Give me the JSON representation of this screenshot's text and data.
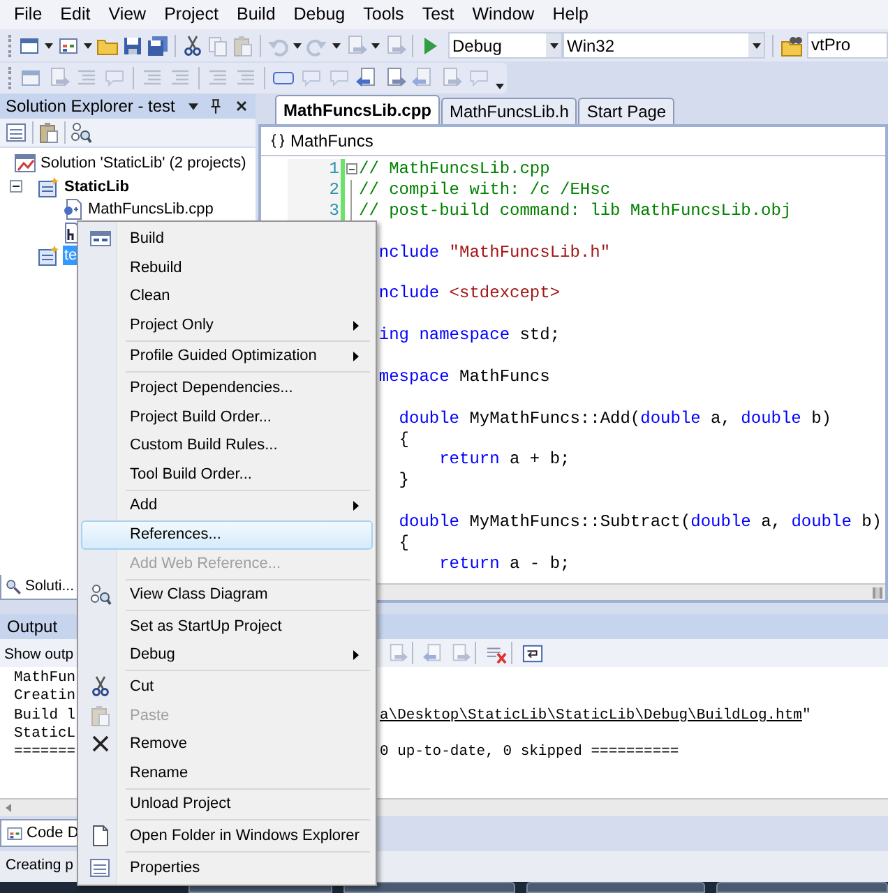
{
  "menu_bar": [
    "File",
    "Edit",
    "View",
    "Project",
    "Build",
    "Debug",
    "Tools",
    "Test",
    "Window",
    "Help"
  ],
  "toolbar": {
    "configuration": "Debug",
    "platform": "Win32",
    "find_box": "vtPro"
  },
  "solution_explorer": {
    "title": "Solution Explorer - test",
    "tree": [
      {
        "label": "Solution 'StaticLib' (2 projects)",
        "kind": "solution",
        "selected": false,
        "children": [
          {
            "label": "StaticLib",
            "kind": "project",
            "startup": true,
            "expanded": true,
            "selected": false,
            "children": [
              {
                "label": "MathFuncsLib.cpp",
                "kind": "cpp",
                "selected": false
              },
              {
                "kind": "header",
                "selected": false
              }
            ]
          },
          {
            "label": "te",
            "kind": "project",
            "startup": false,
            "selected": true
          }
        ]
      }
    ],
    "bottom_tab": "Soluti..."
  },
  "editor": {
    "tabs": [
      {
        "label": "MathFuncsLib.cpp",
        "selected": true
      },
      {
        "label": "MathFuncsLib.h",
        "selected": false
      },
      {
        "label": "Start Page",
        "selected": false
      }
    ],
    "navigation": "MathFuncs",
    "code_lines": [
      {
        "kind": "code",
        "number": "1",
        "collapsible": true,
        "segments": [
          {
            "kind": "comment",
            "text": "// MathFuncsLib.cpp"
          }
        ]
      },
      {
        "kind": "code",
        "number": "2",
        "segments": [
          {
            "kind": "comment",
            "text": "// compile with: /c /EHsc"
          }
        ]
      },
      {
        "kind": "code",
        "number": "3",
        "segments": [
          {
            "kind": "comment",
            "text": "// post-build command: lib MathFuncsLib.obj"
          }
        ]
      },
      {
        "kind": "blank"
      },
      {
        "kind": "code",
        "segments": [
          {
            "kind": "keyword",
            "text": "  nclude"
          },
          {
            "kind": "string",
            "text": " \"MathFuncsLib.h\""
          }
        ]
      },
      {
        "kind": "blank"
      },
      {
        "kind": "code",
        "segments": [
          {
            "kind": "keyword",
            "text": "  nclude"
          },
          {
            "kind": "string",
            "text": " <stdexcept>"
          }
        ]
      },
      {
        "kind": "blank"
      },
      {
        "kind": "code",
        "segments": [
          {
            "kind": "keyword",
            "text": "  ing namespace"
          },
          {
            "kind": "plain",
            "text": " std;"
          }
        ]
      },
      {
        "kind": "blank"
      },
      {
        "kind": "code",
        "segments": [
          {
            "kind": "keyword",
            "text": "  mespace"
          },
          {
            "kind": "plain",
            "text": " MathFuncs"
          }
        ]
      },
      {
        "kind": "blank"
      },
      {
        "kind": "code",
        "segments": [
          {
            "kind": "keyword",
            "text": "    double"
          },
          {
            "kind": "plain",
            "text": " MyMathFuncs::Add("
          },
          {
            "kind": "keyword",
            "text": "double"
          },
          {
            "kind": "plain",
            "text": " a, "
          },
          {
            "kind": "keyword",
            "text": "double"
          },
          {
            "kind": "plain",
            "text": " b)"
          }
        ]
      },
      {
        "kind": "code",
        "segments": [
          {
            "kind": "plain",
            "text": "    {"
          }
        ]
      },
      {
        "kind": "code",
        "segments": [
          {
            "kind": "keyword",
            "text": "        return"
          },
          {
            "kind": "plain",
            "text": " a + b;"
          }
        ]
      },
      {
        "kind": "code",
        "segments": [
          {
            "kind": "plain",
            "text": "    }"
          }
        ]
      },
      {
        "kind": "blank"
      },
      {
        "kind": "code",
        "segments": [
          {
            "kind": "keyword",
            "text": "    double"
          },
          {
            "kind": "plain",
            "text": " MyMathFuncs::Subtract("
          },
          {
            "kind": "keyword",
            "text": "double"
          },
          {
            "kind": "plain",
            "text": " a, "
          },
          {
            "kind": "keyword",
            "text": "double"
          },
          {
            "kind": "plain",
            "text": " b)"
          }
        ]
      },
      {
        "kind": "code",
        "segments": [
          {
            "kind": "plain",
            "text": "    {"
          }
        ]
      },
      {
        "kind": "code",
        "segments": [
          {
            "kind": "keyword",
            "text": "        return"
          },
          {
            "kind": "plain",
            "text": " a - b;"
          }
        ]
      }
    ]
  },
  "output": {
    "title": "Output",
    "show_output_label": "Show outp",
    "lines": [
      {
        "left": "MathFun"
      },
      {
        "left": "Creatin"
      },
      {
        "left": "Build l",
        "link": "a\\Desktop\\StaticLib\\StaticLib\\Debug\\BuildLog.htm",
        "right": "\""
      },
      {
        "left": "StaticL"
      },
      {
        "left": "=======",
        "right": "0 up-to-date, 0 skipped =========="
      }
    ]
  },
  "bottom_tab": "Code D",
  "status_bar": "Creating p",
  "context_menu": [
    {
      "kind": "item",
      "label": "Build",
      "disabled": false,
      "selected": false,
      "submenu": false
    },
    {
      "kind": "item",
      "label": "Rebuild",
      "disabled": false,
      "selected": false,
      "submenu": false
    },
    {
      "kind": "item",
      "label": "Clean",
      "disabled": false,
      "selected": false,
      "submenu": false
    },
    {
      "kind": "item",
      "label": "Project Only",
      "disabled": false,
      "selected": false,
      "submenu": true
    },
    {
      "kind": "separator"
    },
    {
      "kind": "item",
      "label": "Profile Guided Optimization",
      "disabled": false,
      "selected": false,
      "submenu": true
    },
    {
      "kind": "separator"
    },
    {
      "kind": "item",
      "label": "Project Dependencies...",
      "disabled": false,
      "selected": false,
      "submenu": false
    },
    {
      "kind": "item",
      "label": "Project Build Order...",
      "disabled": false,
      "selected": false,
      "submenu": false
    },
    {
      "kind": "item",
      "label": "Custom Build Rules...",
      "disabled": false,
      "selected": false,
      "submenu": false
    },
    {
      "kind": "item",
      "label": "Tool Build Order...",
      "disabled": false,
      "selected": false,
      "submenu": false
    },
    {
      "kind": "separator"
    },
    {
      "kind": "item",
      "label": "Add",
      "disabled": false,
      "selected": false,
      "submenu": true
    },
    {
      "kind": "item",
      "label": "References...",
      "disabled": false,
      "selected": true,
      "submenu": false
    },
    {
      "kind": "item",
      "label": "Add Web Reference...",
      "disabled": true,
      "selected": false,
      "submenu": false
    },
    {
      "kind": "separator"
    },
    {
      "kind": "item",
      "label": "View Class Diagram",
      "disabled": false,
      "selected": false,
      "submenu": false
    },
    {
      "kind": "separator"
    },
    {
      "kind": "item",
      "label": "Set as StartUp Project",
      "disabled": false,
      "selected": false,
      "submenu": false
    },
    {
      "kind": "item",
      "label": "Debug",
      "disabled": false,
      "selected": false,
      "submenu": true
    },
    {
      "kind": "separator"
    },
    {
      "kind": "item",
      "label": "Cut",
      "disabled": false,
      "selected": false,
      "submenu": false
    },
    {
      "kind": "item",
      "label": "Paste",
      "disabled": true,
      "selected": false,
      "submenu": false
    },
    {
      "kind": "item",
      "label": "Remove",
      "disabled": false,
      "selected": false,
      "submenu": false
    },
    {
      "kind": "item",
      "label": "Rename",
      "disabled": false,
      "selected": false,
      "submenu": false
    },
    {
      "kind": "separator"
    },
    {
      "kind": "item",
      "label": "Unload Project",
      "disabled": false,
      "selected": false,
      "submenu": false
    },
    {
      "kind": "separator"
    },
    {
      "kind": "item",
      "label": "Open Folder in Windows Explorer",
      "disabled": false,
      "selected": false,
      "submenu": false
    },
    {
      "kind": "separator"
    },
    {
      "kind": "item",
      "label": "Properties",
      "disabled": false,
      "selected": false,
      "submenu": false
    }
  ]
}
